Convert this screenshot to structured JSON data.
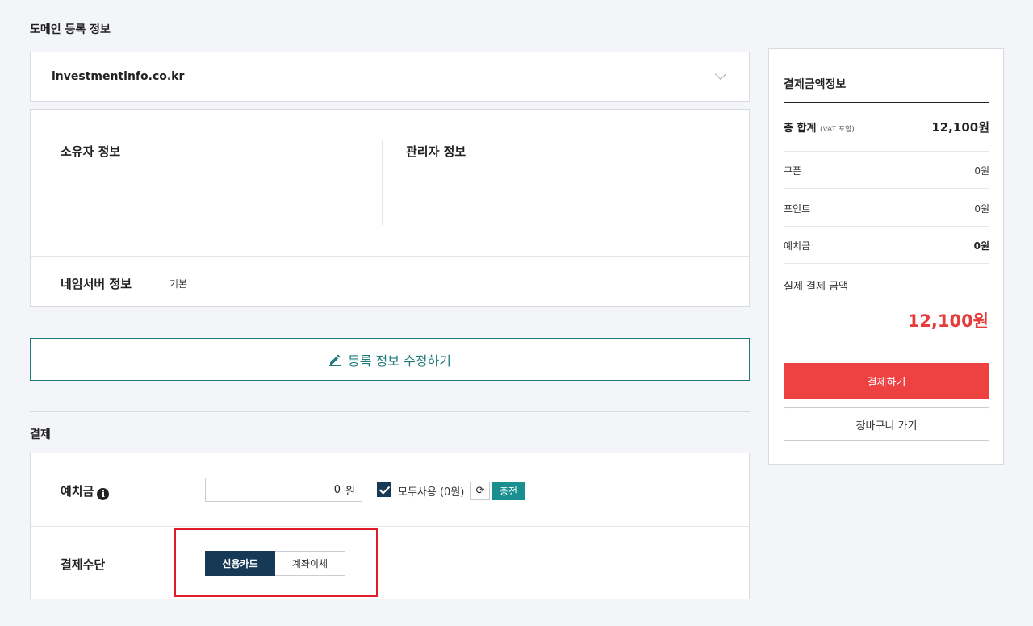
{
  "domain_section": {
    "title": "도메인 등록 정보",
    "selected_domain": "investmentinfo.co.kr"
  },
  "info": {
    "owner_title": "소유자 정보",
    "admin_title": "관리자 정보",
    "nameserver_title": "네임서버 정보",
    "nameserver_value": "기본"
  },
  "edit_button": {
    "label": "등록 정보 수정하기",
    "icon": "pencil-icon"
  },
  "payment": {
    "title": "결제",
    "deposit_label": "예치금",
    "deposit_value": "0",
    "deposit_unit": "원",
    "use_all_label": "모두사용 (0원)",
    "use_all_checked": true,
    "charge_label": "충전",
    "method_label": "결제수단",
    "methods": [
      "신용카드",
      "계좌이체"
    ],
    "selected_method": "신용카드"
  },
  "summary": {
    "title": "결제금액정보",
    "total_label": "총 합계",
    "vat_note": "(VAT 포함)",
    "total_value": "12,100원",
    "coupon_label": "쿠폰",
    "coupon_value": "0원",
    "point_label": "포인트",
    "point_value": "0원",
    "deposit_label": "예치금",
    "deposit_value": "0원",
    "final_label": "실제 결제 금액",
    "final_value": "12,100원",
    "pay_button": "결제하기",
    "cart_button": "장바구니 가기"
  },
  "colors": {
    "accent_teal": "#1f7a7a",
    "navy": "#163a56",
    "red": "#ee4141",
    "highlight": "#e21b2b"
  }
}
